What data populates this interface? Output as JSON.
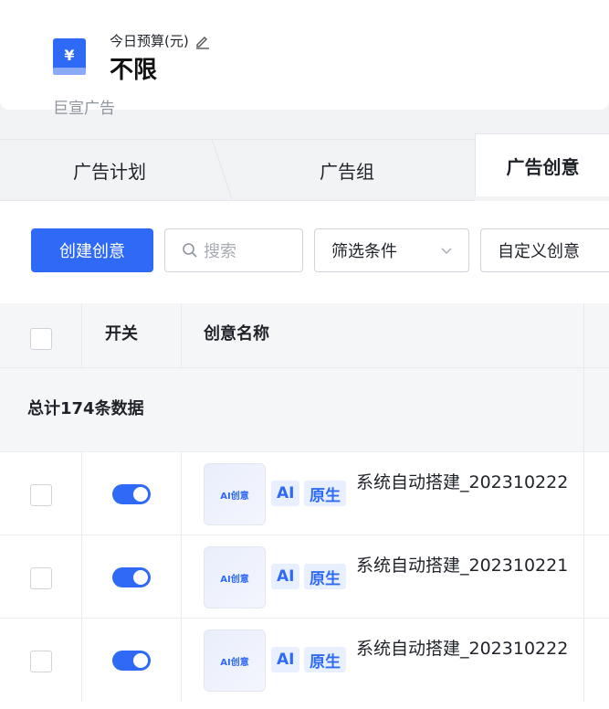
{
  "budget": {
    "label": "今日预算(元)",
    "value": "不限",
    "brand": "巨宣广告",
    "icon_char": "¥"
  },
  "tabs": [
    {
      "label": "广告计划",
      "active": false
    },
    {
      "label": "广告组",
      "active": false
    },
    {
      "label": "广告创意",
      "active": true
    }
  ],
  "toolbar": {
    "create_label": "创建创意",
    "search_placeholder": "搜索",
    "filter_label": "筛选条件",
    "custom_label": "自定义创意"
  },
  "table": {
    "headers": {
      "switch": "开关",
      "name": "创意名称"
    },
    "summary": "总计174条数据",
    "rows": [
      {
        "thumb": "AI创意",
        "tag_ai": "AI",
        "tag_native": "原生",
        "name": "系统自动搭建_202310222",
        "enabled": true
      },
      {
        "thumb": "AI创意",
        "tag_ai": "AI",
        "tag_native": "原生",
        "name": "系统自动搭建_202310221",
        "enabled": true
      },
      {
        "thumb": "AI创意",
        "tag_ai": "AI",
        "tag_native": "原生",
        "name": "系统自动搭建_202310222",
        "enabled": true
      }
    ]
  },
  "colors": {
    "accent": "#2f6af6"
  }
}
